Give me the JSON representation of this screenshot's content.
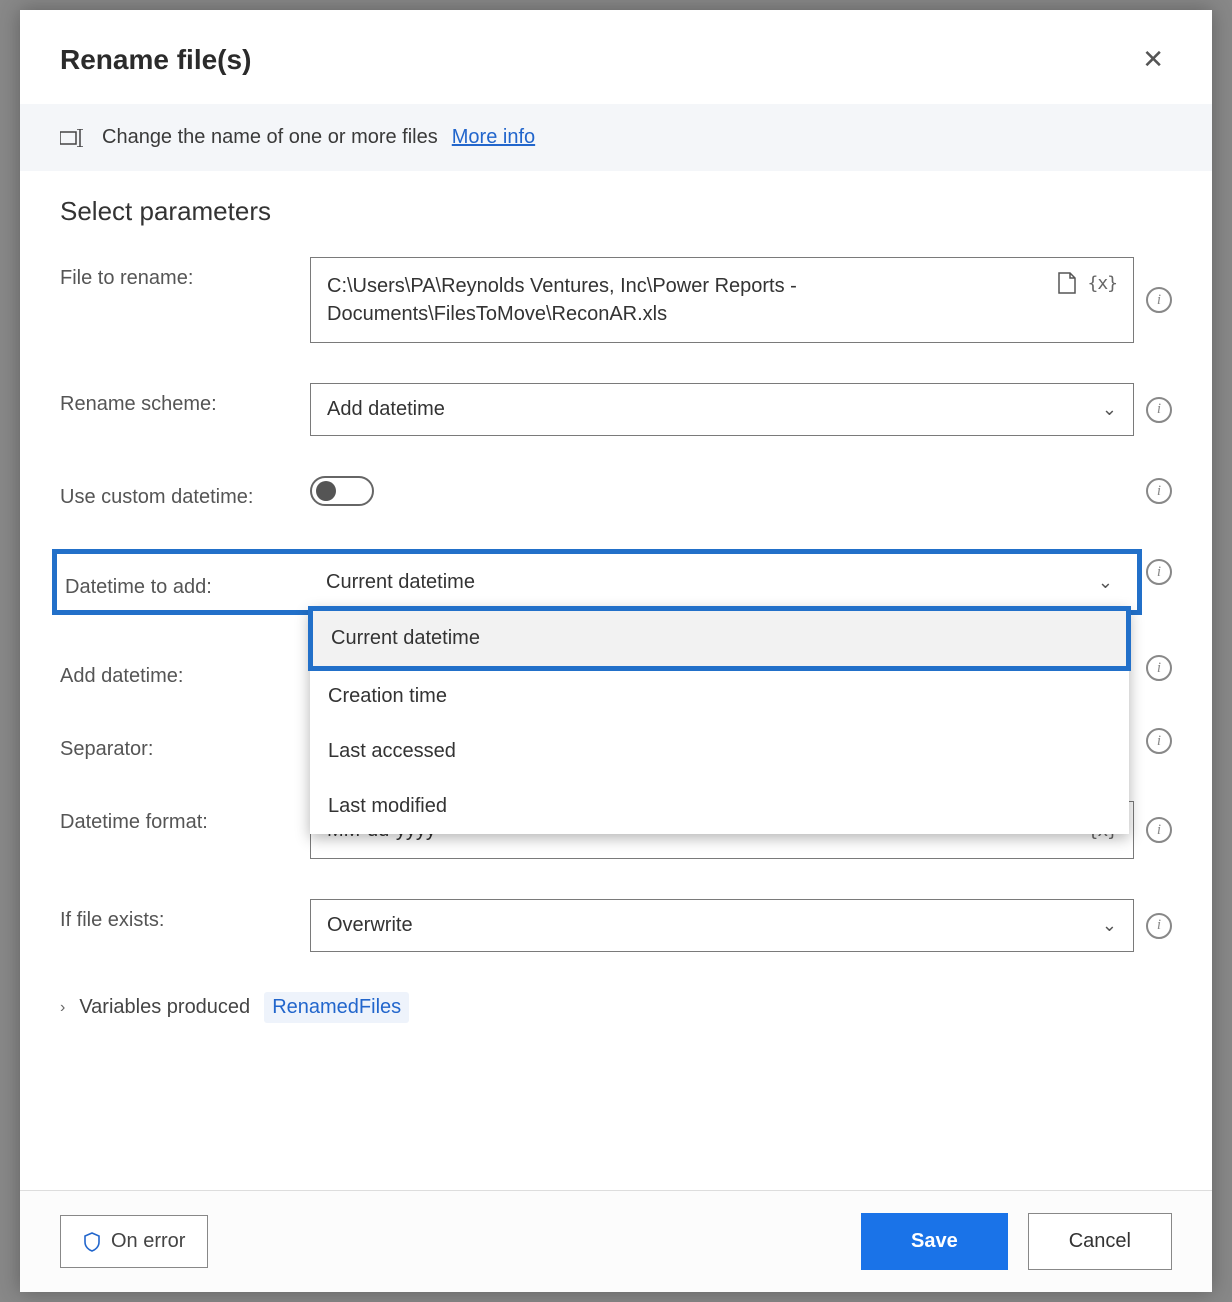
{
  "dialog": {
    "title": "Rename file(s)",
    "banner_text": "Change the name of one or more files",
    "more_info": "More info"
  },
  "section": {
    "title": "Select parameters"
  },
  "fields": {
    "file_to_rename": {
      "label": "File to rename:",
      "value": "C:\\Users\\PA\\Reynolds Ventures, Inc\\Power Reports - Documents\\FilesToMove\\ReconAR.xls"
    },
    "rename_scheme": {
      "label": "Rename scheme:",
      "value": "Add datetime"
    },
    "use_custom_datetime": {
      "label": "Use custom datetime:",
      "value": false
    },
    "datetime_to_add": {
      "label": "Datetime to add:",
      "value": "Current datetime",
      "options": [
        "Current datetime",
        "Creation time",
        "Last accessed",
        "Last modified"
      ]
    },
    "add_datetime": {
      "label": "Add datetime:"
    },
    "separator": {
      "label": "Separator:"
    },
    "datetime_format": {
      "label": "Datetime format:",
      "value": "MM-dd-yyyy"
    },
    "if_file_exists": {
      "label": "If file exists:",
      "value": "Overwrite"
    }
  },
  "variables": {
    "label": "Variables produced",
    "value": "RenamedFiles"
  },
  "footer": {
    "on_error": "On error",
    "save": "Save",
    "cancel": "Cancel"
  }
}
